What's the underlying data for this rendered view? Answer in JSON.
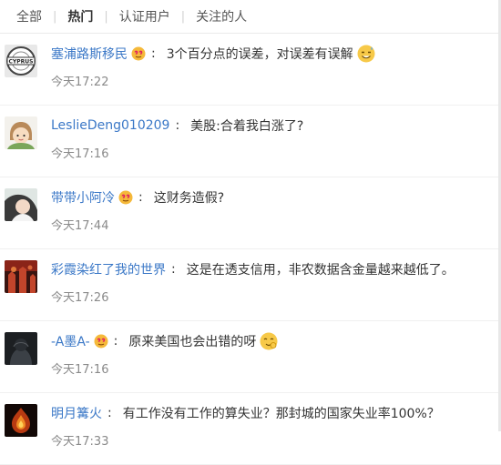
{
  "tabs": [
    {
      "label": "全部"
    },
    {
      "label": "热门"
    },
    {
      "label": "认证用户"
    },
    {
      "label": "关注的人"
    }
  ],
  "comments": [
    {
      "user": "塞浦路斯移民",
      "text": "3个百分点的误差，对误差有误解",
      "time": "今天17:22",
      "avatar_text": "CYPRUS"
    },
    {
      "user": "LeslieDeng010209",
      "text": "美股:合着我白涨了?",
      "time": "今天17:16"
    },
    {
      "user": "带带小阿冷",
      "text": "这财务造假?",
      "time": "今天17:44"
    },
    {
      "user": "彩霞染红了我的世界",
      "text": "这是在透支信用，非农数据含金量越来越低了。",
      "time": "今天17:26"
    },
    {
      "user": "-A墨A-",
      "text": "原来美国也会出错的呀",
      "time": "今天17:16"
    },
    {
      "user": "明月篝火",
      "text": "有工作没有工作的算失业？那封城的国家失业率100%？",
      "time": "今天17:33"
    }
  ]
}
